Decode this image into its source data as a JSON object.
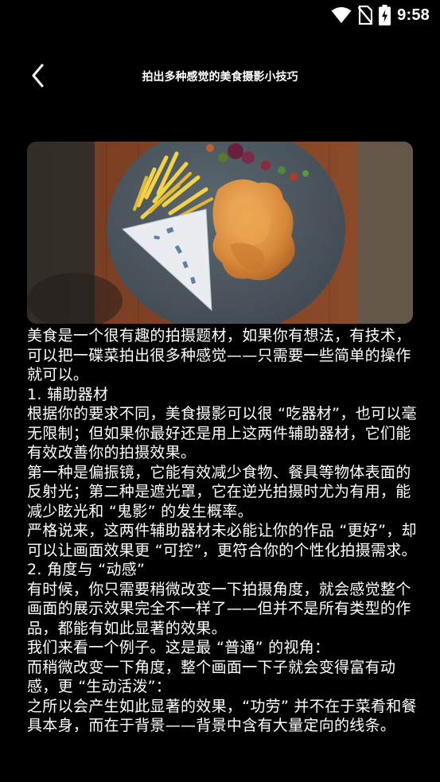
{
  "status_bar": {
    "time": "9:58",
    "icons": [
      "wifi-icon",
      "no-sim-icon",
      "battery-charging-icon"
    ]
  },
  "header": {
    "back_icon": "chevron-left-icon",
    "title": "拍出多种感觉的美食摄影小技巧"
  },
  "hero_image": {
    "subject": "fries-and-fried-chicken-on-slate-plate"
  },
  "article": {
    "paragraphs": [
      "美食是一个很有趣的拍摄题材，如果你有想法，有技术，可以把一碟菜拍出很多种感觉——只需要一些简单的操作就可以。",
      "1. 辅助器材",
      "根据你的要求不同，美食摄影可以很 “吃器材”，也可以毫无限制；但如果你最好还是用上这两件辅助器材，它们能有效改善你的拍摄效果。",
      "第一种是偏振镜，它能有效减少食物、餐具等物体表面的反射光；第二种是遮光罩，它在逆光拍摄时尤为有用，能减少眩光和 “鬼影” 的发生概率。",
      "严格说来，这两件辅助器材未必能让你的作品 “更好”，却可以让画面效果更 “可控”，更符合你的个性化拍摄需求。",
      "2. 角度与 “动感”",
      "有时候，你只需要稍微改变一下拍摄角度，就会感觉整个画面的展示效果完全不一样了——但并不是所有类型的作品，都能有如此显著的效果。",
      "我们来看一个例子。这是最 “普通” 的视角：",
      "而稍微改变一下角度，整个画面一下子就会变得富有动感，更 “生动活泼”：",
      "之所以会产生如此显著的效果，“功劳” 并不在于菜肴和餐具本身，而在于背景——背景中含有大量定向的线条。"
    ]
  }
}
